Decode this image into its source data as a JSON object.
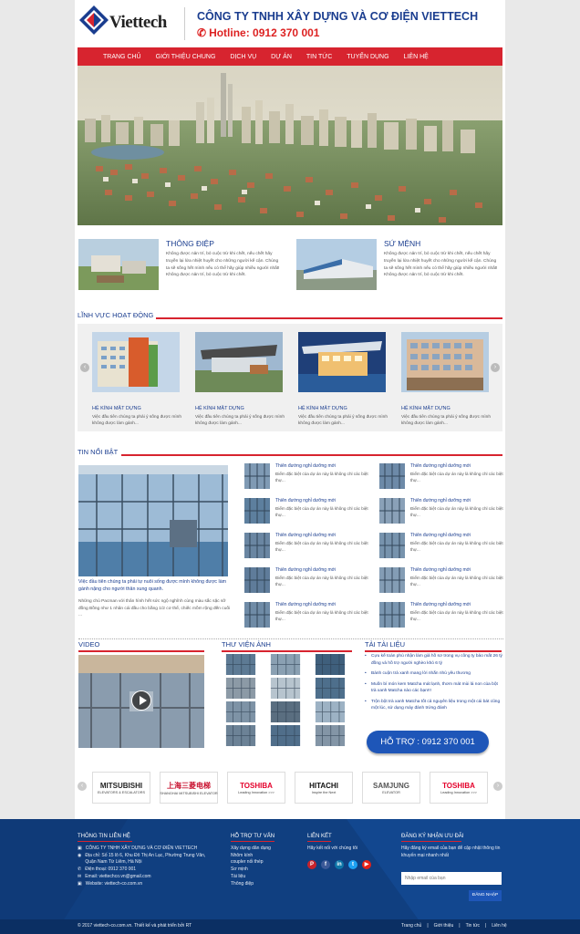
{
  "header": {
    "logo_text": "Viettech",
    "company_name": "CÔNG TY TNHH XÂY DỰNG VÀ CƠ ĐIỆN VIETTECH",
    "hotline": "Hotline: 0912 370 001"
  },
  "nav": [
    "TRANG CHỦ",
    "GIỚI THIỆU CHUNG",
    "DỊCH VỤ",
    "DỰ ÁN",
    "TIN TỨC",
    "TUYỂN DỤNG",
    "LIÊN HỆ"
  ],
  "intro": [
    {
      "title": "THÔNG ĐIỆP",
      "text": "Không được nản trí, bỏ cuộc trừ khi chết, nếu chết hãy truyền lại lửa nhiệt huyết cho những người kế cận. Chúng ta sẽ sống hết mình nếu có thể hãy giúp nhiều người nhất! Không được nản trí, bỏ cuộc trừ khi chết."
    },
    {
      "title": "SỨ MỆNH",
      "text": "Không được nản trí, bỏ cuộc trừ khi chết, nếu chết hãy truyền lại lửa nhiệt huyết cho những người kế cận. Chúng ta sẽ sống hết mình nếu có thể hãy giúp nhiều người nhất! Không được nản trí, bỏ cuộc trừ khi chết."
    }
  ],
  "linh_vuc": {
    "title": "LĨNH VỰC HOẠT ĐỘNG",
    "items": [
      {
        "title": "HỆ KÍNH MẶT DỰNG",
        "desc": "Việc đầu tiên chúng ta phải ý sống được mình không được làm gánh..."
      },
      {
        "title": "HỆ KÍNH MẶT DỰNG",
        "desc": "Việc đầu tiên chúng ta phải ý sống được mình không được làm gánh..."
      },
      {
        "title": "HỆ KÍNH MẶT DỰNG",
        "desc": "Việc đầu tiên chúng ta phải ý sống được mình không được làm gánh..."
      },
      {
        "title": "HỆ KÍNH MẶT DỰNG",
        "desc": "Việc đầu tiên chúng ta phải ý sống được mình không được làm gánh..."
      }
    ]
  },
  "tin_noi_bat": {
    "title": "TIN NỔI BẬT",
    "main_caption": "Việc đầu tiên chúng ta phải tự nuôi sống được mình không được làm gánh nặng cho người thân xung quanh.",
    "main_sub": "Những chú Pacman với thân hình hết sức ngộ nghĩnh cùng màu sắc sặc sỡ đồng Bồng như 1 nhân cái đầu cho bằng 1/2 cơ thể, chiếc mồm rộng đến cuối ...",
    "items": [
      {
        "title": "Thiên đường nghỉ dưỡng mới",
        "desc": "Điểm đặc biệt của dự án này là không chỉ các biệt thự..."
      },
      {
        "title": "Thiên đường nghỉ dưỡng mới",
        "desc": "Điểm đặc biệt của dự án này là không chỉ các biệt thự..."
      },
      {
        "title": "Thiên đường nghỉ dưỡng mới",
        "desc": "Điểm đặc biệt của dự án này là không chỉ các biệt thự..."
      },
      {
        "title": "Thiên đường nghỉ dưỡng mới",
        "desc": "Điểm đặc biệt của dự án này là không chỉ các biệt thự..."
      },
      {
        "title": "Thiên đường nghỉ dưỡng mới",
        "desc": "Điểm đặc biệt của dự án này là không chỉ các biệt thự..."
      },
      {
        "title": "Thiên đường nghỉ dưỡng mới",
        "desc": "Điểm đặc biệt của dự án này là không chỉ các biệt thự..."
      },
      {
        "title": "Thiên đường nghỉ dưỡng mới",
        "desc": "Điểm đặc biệt của dự án này là không chỉ các biệt thự..."
      },
      {
        "title": "Thiên đường nghỉ dưỡng mới",
        "desc": "Điểm đặc biệt của dự án này là không chỉ các biệt thự..."
      },
      {
        "title": "Thiên đường nghỉ dưỡng mới",
        "desc": "Điểm đặc biệt của dự án này là không chỉ các biệt thự..."
      },
      {
        "title": "Thiên đường nghỉ dưỡng mới",
        "desc": "Điểm đặc biệt của dự án này là không chỉ các biệt thự..."
      }
    ]
  },
  "video": {
    "title": "VIDEO"
  },
  "gallery": {
    "title": "THƯ VIỆN ẢNH"
  },
  "docs": {
    "title": "TẢI TÀI LIỆU",
    "items": [
      "Cựu kế toán phủ nhận làm giả hồ sơ trong vụ công ty bảo mất 26 tỷ đồng và hồ trợ người nghèo khó 6 tỷ",
      "Bánh cuộn trà xanh mang lời nhắn nhủ yêu thương",
      "Muốn bí món kem Matcha mát lạnh, thơm mát mùi lá non của bột trà xanh Matcha nào các bạn!!!",
      "Trộn bột trà xanh Matcha tốt cả nguyên liệu trong một cái bát cũng một lúc, sử dụng máy đánh trứng đánh"
    ],
    "support_button": "HỖ TRỢ : 0912 370 001"
  },
  "partners": [
    {
      "name": "MITSUBISHI",
      "sub": "ELEVATORS & ESCALATORS",
      "color": "#222222"
    },
    {
      "name": "上海三菱电梯",
      "sub": "SHANGHAI MITSUBISHI ELEVATOR",
      "color": "#c8102e"
    },
    {
      "name": "TOSHIBA",
      "sub": "Leading Innovation >>>",
      "color": "#e4002b"
    },
    {
      "name": "HITACHI",
      "sub": "Inspire the Next",
      "color": "#111111"
    },
    {
      "name": "SAMJUNG",
      "sub": "ELEVATOR",
      "color": "#555555"
    },
    {
      "name": "TOSHIBA",
      "sub": "Leading Innovation >>>",
      "color": "#e4002b"
    }
  ],
  "footer": {
    "contact_title": "THÔNG TIN LIÊN HỆ",
    "company": "CÔNG TY TNHH XÂY DỰNG VÀ CƠ ĐIỆN VIETTECH",
    "address": "Địa chỉ: Số 15 lô 6, Khu Đô Thị An Lạc, Phường Trung Văn, Quận Nam Từ Liêm, Hà Nội",
    "phone": "Điện thoại: 0912 370 001",
    "email": "Email: viettechco.vn@gmail.com",
    "website": "Website: viettech-co.com.vn",
    "support_title": "HỖ TRỢ TƯ VẤN",
    "support_links": [
      "Xây dựng dân dụng",
      "Nhôm kính",
      "coupler nối thép",
      "Sơ mịnh",
      "Tài liệu",
      "Thông điệp"
    ],
    "connect_title": "LIÊN KẾT",
    "connect_text": "Hãy kết nối với chúng tôi",
    "newsletter_title": "ĐĂNG KÝ NHẬN ƯU ĐÃI",
    "newsletter_text": "Hãy đăng ký email của bạn để cập nhật thông tin khuyến mại nhanh nhất",
    "email_placeholder": "Nhập email của bạn",
    "subscribe_label": "ĐĂNG NHẬP",
    "copyright": "© 2017 viettech-co.com.vn. Thiết kế và phát triển bởi RT",
    "bottom_links": [
      "Trang chủ",
      "Giới thiệu",
      "Tin tức",
      "Liên hệ"
    ]
  }
}
